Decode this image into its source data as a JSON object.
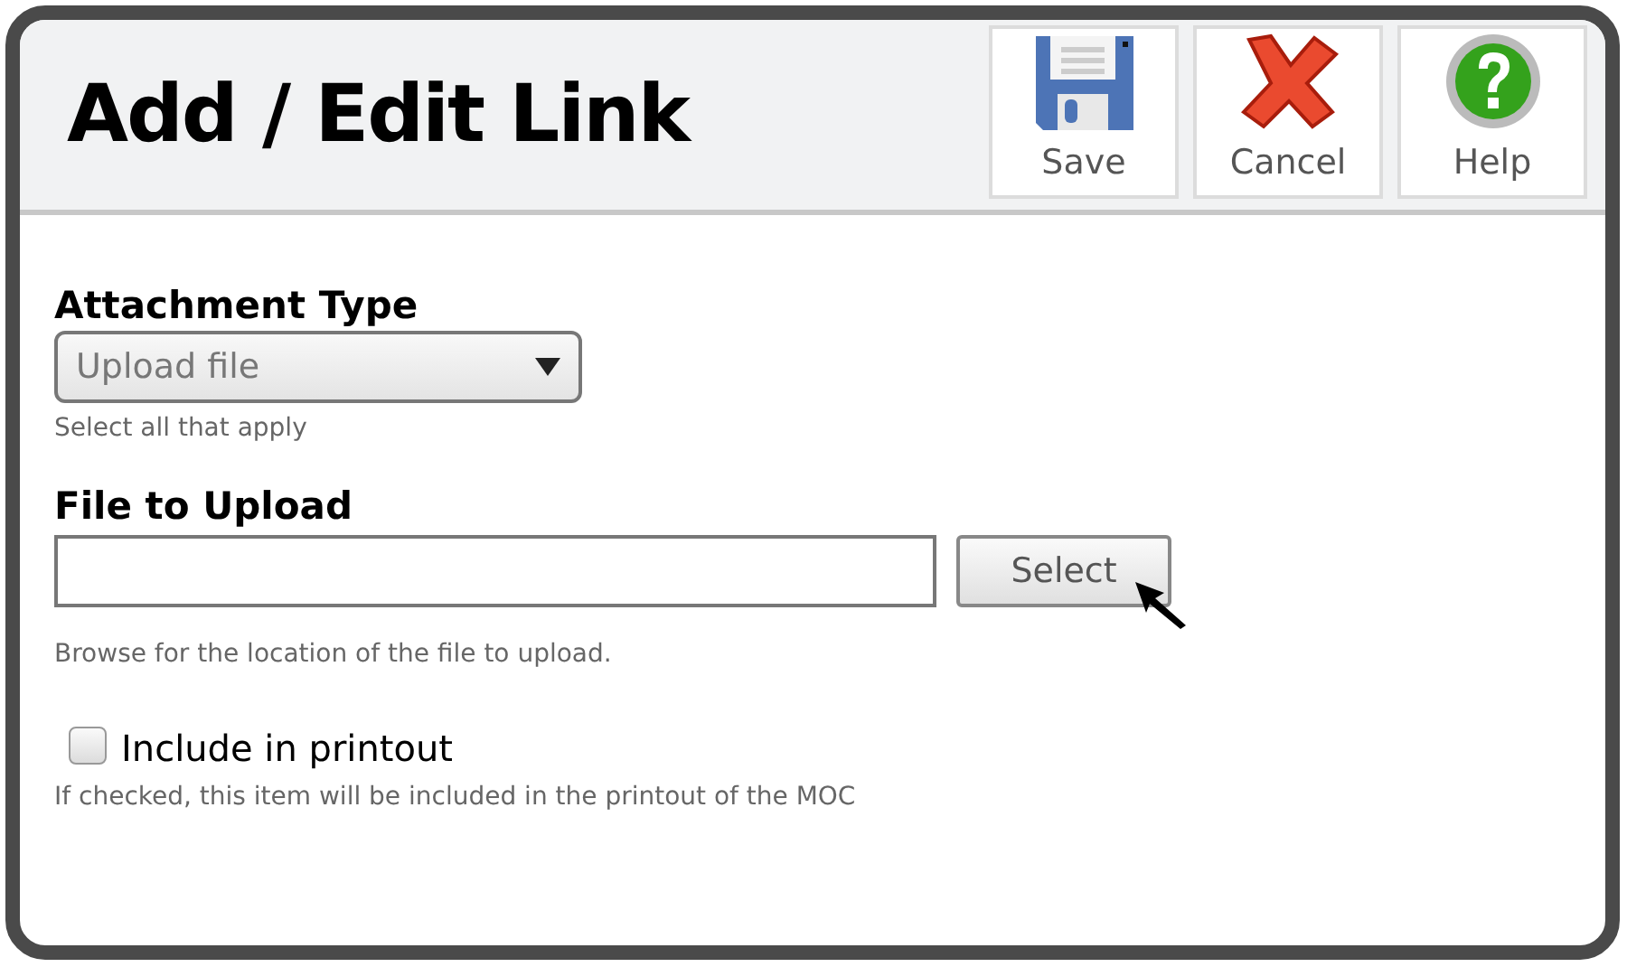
{
  "window": {
    "title": "Add / Edit Link"
  },
  "toolbar": [
    {
      "kind": "save",
      "label": "Save"
    },
    {
      "kind": "cancel",
      "label": "Cancel"
    },
    {
      "kind": "help",
      "label": "Help"
    }
  ],
  "attachment_type": {
    "label": "Attachment Type",
    "value": "Upload file",
    "hint": "Select all that apply"
  },
  "file_to_upload": {
    "label": "File to Upload",
    "button": "Select",
    "hint": "Browse for the location of the file to upload."
  },
  "include_in_printout": {
    "label": "Include in printout",
    "checked": false,
    "hint": "If checked, this item will be included in the printout of the MOC"
  }
}
